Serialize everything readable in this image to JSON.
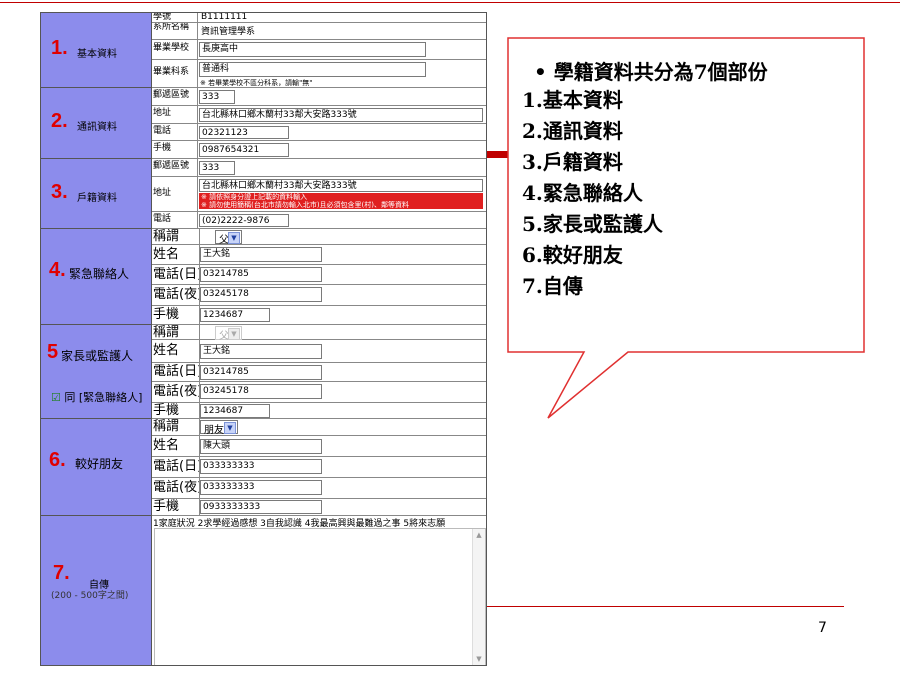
{
  "form": {
    "s1": {
      "num": "1.",
      "title": "基本資料",
      "rows": [
        {
          "label": "學號",
          "value": "B1111111"
        },
        {
          "label": "系所名稱",
          "value": "資訊管理學系"
        },
        {
          "label": "畢業學校",
          "value": "長庚高中"
        },
        {
          "label": "畢業科系",
          "value": "普通科",
          "note": "※ 若畢業學校不區分科系，請輸\"無\""
        }
      ]
    },
    "s2": {
      "num": "2.",
      "title": "通訊資料",
      "rows": [
        {
          "label": "郵遞區號",
          "value": "333"
        },
        {
          "label": "地址",
          "value": "台北縣林口鄉木蘭村33鄰大安路333號"
        },
        {
          "label": "電話",
          "value": "02321123"
        },
        {
          "label": "手機",
          "value": "0987654321"
        }
      ]
    },
    "s3": {
      "num": "3.",
      "title": "戶籍資料",
      "rows": [
        {
          "label": "郵遞區號",
          "value": "333"
        },
        {
          "label": "地址",
          "value": "台北縣林口鄉木蘭村33鄰大安路333號",
          "warn1": "※ 請依照身分證上記載的資料輸入",
          "warn2": "※ 請勿使用簡稱(台北市請勿輸入北市)且必須包含里(村)、鄰等資料"
        },
        {
          "label": "電話",
          "value": "(02)2222-9876"
        }
      ]
    },
    "s4": {
      "num": "4.",
      "title": "緊急聯絡人",
      "rows": [
        {
          "label": "稱謂",
          "value": "父"
        },
        {
          "label": "姓名",
          "value": "王大銘"
        },
        {
          "label": "電話(日)",
          "value": "03214785"
        },
        {
          "label": "電話(夜)",
          "value": "03245178"
        },
        {
          "label": "手機",
          "value": "1234687"
        }
      ]
    },
    "s5": {
      "num": "5",
      "title": "家長或監護人",
      "checkbox_label": "同 [緊急聯絡人]",
      "checkbox_mark": "☑",
      "rows": [
        {
          "label": "稱謂",
          "value": "父"
        },
        {
          "label": "姓名",
          "value": "王大銘"
        },
        {
          "label": "電話(日)",
          "value": "03214785"
        },
        {
          "label": "電話(夜)",
          "value": "03245178"
        },
        {
          "label": "手機",
          "value": "1234687"
        }
      ]
    },
    "s6": {
      "num": "6.",
      "title": "較好朋友",
      "rows": [
        {
          "label": "稱謂",
          "value": "朋友"
        },
        {
          "label": "姓名",
          "value": "陳大頭"
        },
        {
          "label": "電話(日)",
          "value": "033333333"
        },
        {
          "label": "電話(夜)",
          "value": "033333333"
        },
        {
          "label": "手機",
          "value": "0933333333"
        }
      ]
    },
    "s7": {
      "num": "7.",
      "title": "自傳",
      "subtitle": "(200 - 500字之間)",
      "hint": "1家庭狀況 2求學經過感想 3自我認識 4我最高興與最難過之事 5將來志願"
    },
    "select_arrow": "▼"
  },
  "callout": {
    "bullet": "•",
    "heading": "學籍資料共分為7個部份",
    "items": [
      "1.基本資料",
      "2.通訊資料",
      "3.戶籍資料",
      "4.緊急聯絡人",
      "5.家長或監護人",
      "6.較好朋友",
      "7.自傳"
    ]
  },
  "page_number": "7",
  "colors": {
    "accent_red": "#c00000",
    "section_bg": "#8c8cec",
    "label_red": "#e00000"
  }
}
